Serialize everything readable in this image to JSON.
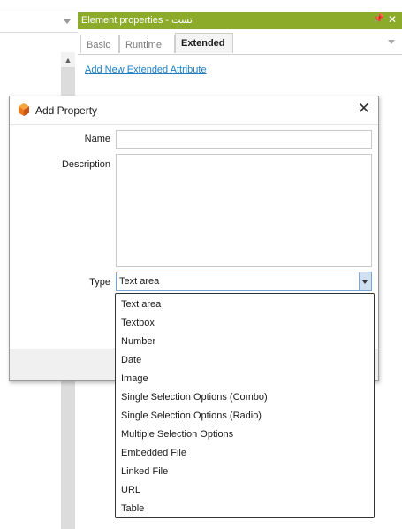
{
  "panel": {
    "title": "Element properties - تست",
    "pin_glyph": "⬤",
    "tabs": [
      {
        "label": "Basic"
      },
      {
        "label": "Runtime"
      },
      {
        "label": "Extended"
      }
    ],
    "active_tab": "Extended",
    "add_link": "Add New Extended Attribute"
  },
  "dialog": {
    "title": "Add Property",
    "close": "✕",
    "name_label": "Name",
    "name_value": "",
    "description_label": "Description",
    "description_value": "",
    "type_label": "Type",
    "type_value": "Text area"
  },
  "type_options": [
    "Text area",
    "Textbox",
    "Number",
    "Date",
    "Image",
    "Single Selection Options (Combo)",
    "Single Selection Options (Radio)",
    "Multiple Selection Options",
    "Embedded File",
    "Linked File",
    "URL",
    "Table"
  ],
  "colors": {
    "panel_header": "#8cab2a",
    "link": "#1a7fc8",
    "logo": "#e8781e"
  }
}
